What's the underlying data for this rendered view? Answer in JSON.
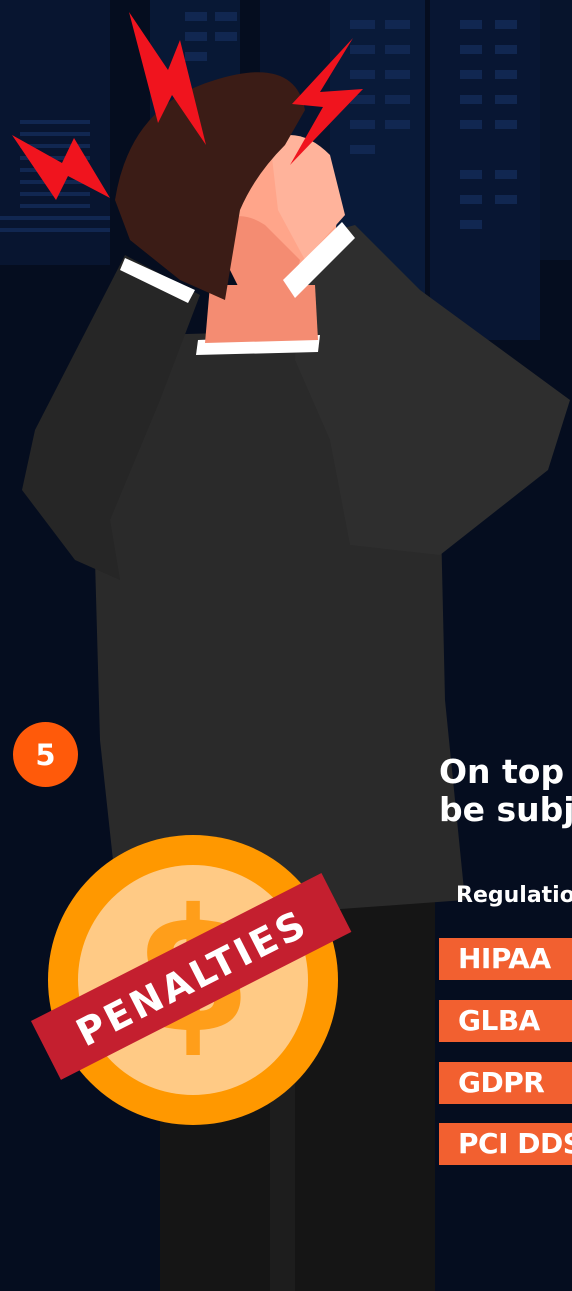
{
  "step_number": "5",
  "headline_line1": "On top",
  "headline_line2": "be subj",
  "regulations_label": "Regulatio",
  "regulations": [
    "HIPAA",
    "GLBA",
    "GDPR",
    "PCI DDS"
  ],
  "stamp_text": "PENALTIES",
  "colors": {
    "background": "#050d1f",
    "accent_orange": "#ff5a0a",
    "tag_orange": "#f26030",
    "coin_orange": "#ff9800",
    "ribbon_red": "#c41f2f",
    "jacket": "#2a2a2a",
    "lightning": "#f0141e"
  }
}
